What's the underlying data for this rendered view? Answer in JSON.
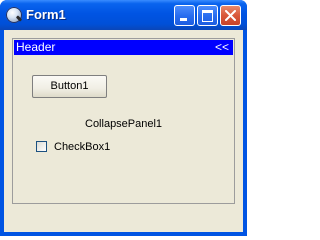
{
  "window": {
    "title": "Form1"
  },
  "panel": {
    "header_title": "Header",
    "collapse_label": "<<",
    "caption": "CollapsePanel1",
    "button_label": "Button1",
    "checkbox_label": "CheckBox1",
    "checkbox_checked": false,
    "header_color": "#0000ff"
  }
}
